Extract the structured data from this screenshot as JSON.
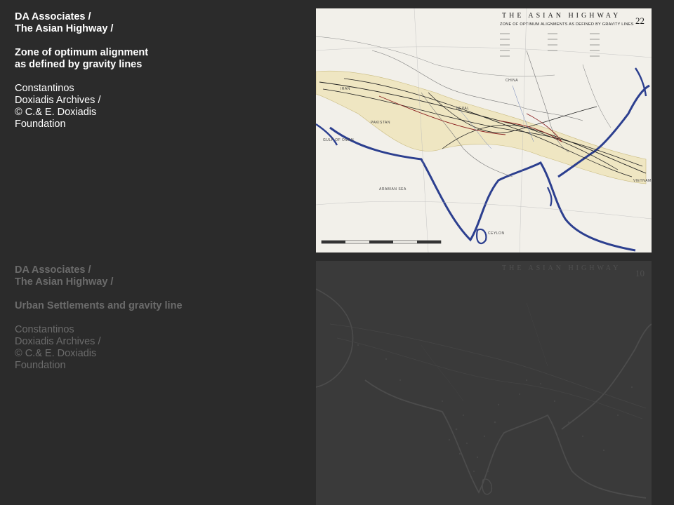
{
  "slides": [
    {
      "header_line1": "DA Associates /",
      "header_line2": "The Asian Highway /",
      "subject_line1": "Zone of optimum alignment",
      "subject_line2": "as defined by gravity lines",
      "credit_line1": "Constantinos",
      "credit_line2": "Doxiadis Archives /",
      "credit_line3": "© C.& E. Doxiadis",
      "credit_line4": "Foundation",
      "map_title": "THE ASIAN HIGHWAY",
      "map_subtitle": "ZONE OF OPTIMUM ALIGNMENTS AS DEFINED BY GRAVITY LINES",
      "map_number": "22",
      "map_labels": [
        "IRAN",
        "PAKISTAN",
        "CHINA",
        "NEPAL",
        "CEYLON",
        "VIETNAM",
        "ARABIAN SEA",
        "GULF OF OMAN"
      ]
    },
    {
      "header_line1": "DA Associates /",
      "header_line2": "The Asian Highway /",
      "subject_line1": "Urban Settlements and gravity line",
      "credit_line1": "Constantinos",
      "credit_line2": "Doxiadis Archives /",
      "credit_line3": "© C.& E. Doxiadis",
      "credit_line4": "Foundation",
      "map_title": "THE ASIAN HIGHWAY",
      "map_number": "10"
    }
  ],
  "colors": {
    "background": "#2b2b2b",
    "active_text": "#ffffff",
    "dimmed_text": "#6b6b6b",
    "map_paper": "#f2f0ea",
    "coastline": "#2c3f8f",
    "highway_zone": "#efe6c2"
  }
}
